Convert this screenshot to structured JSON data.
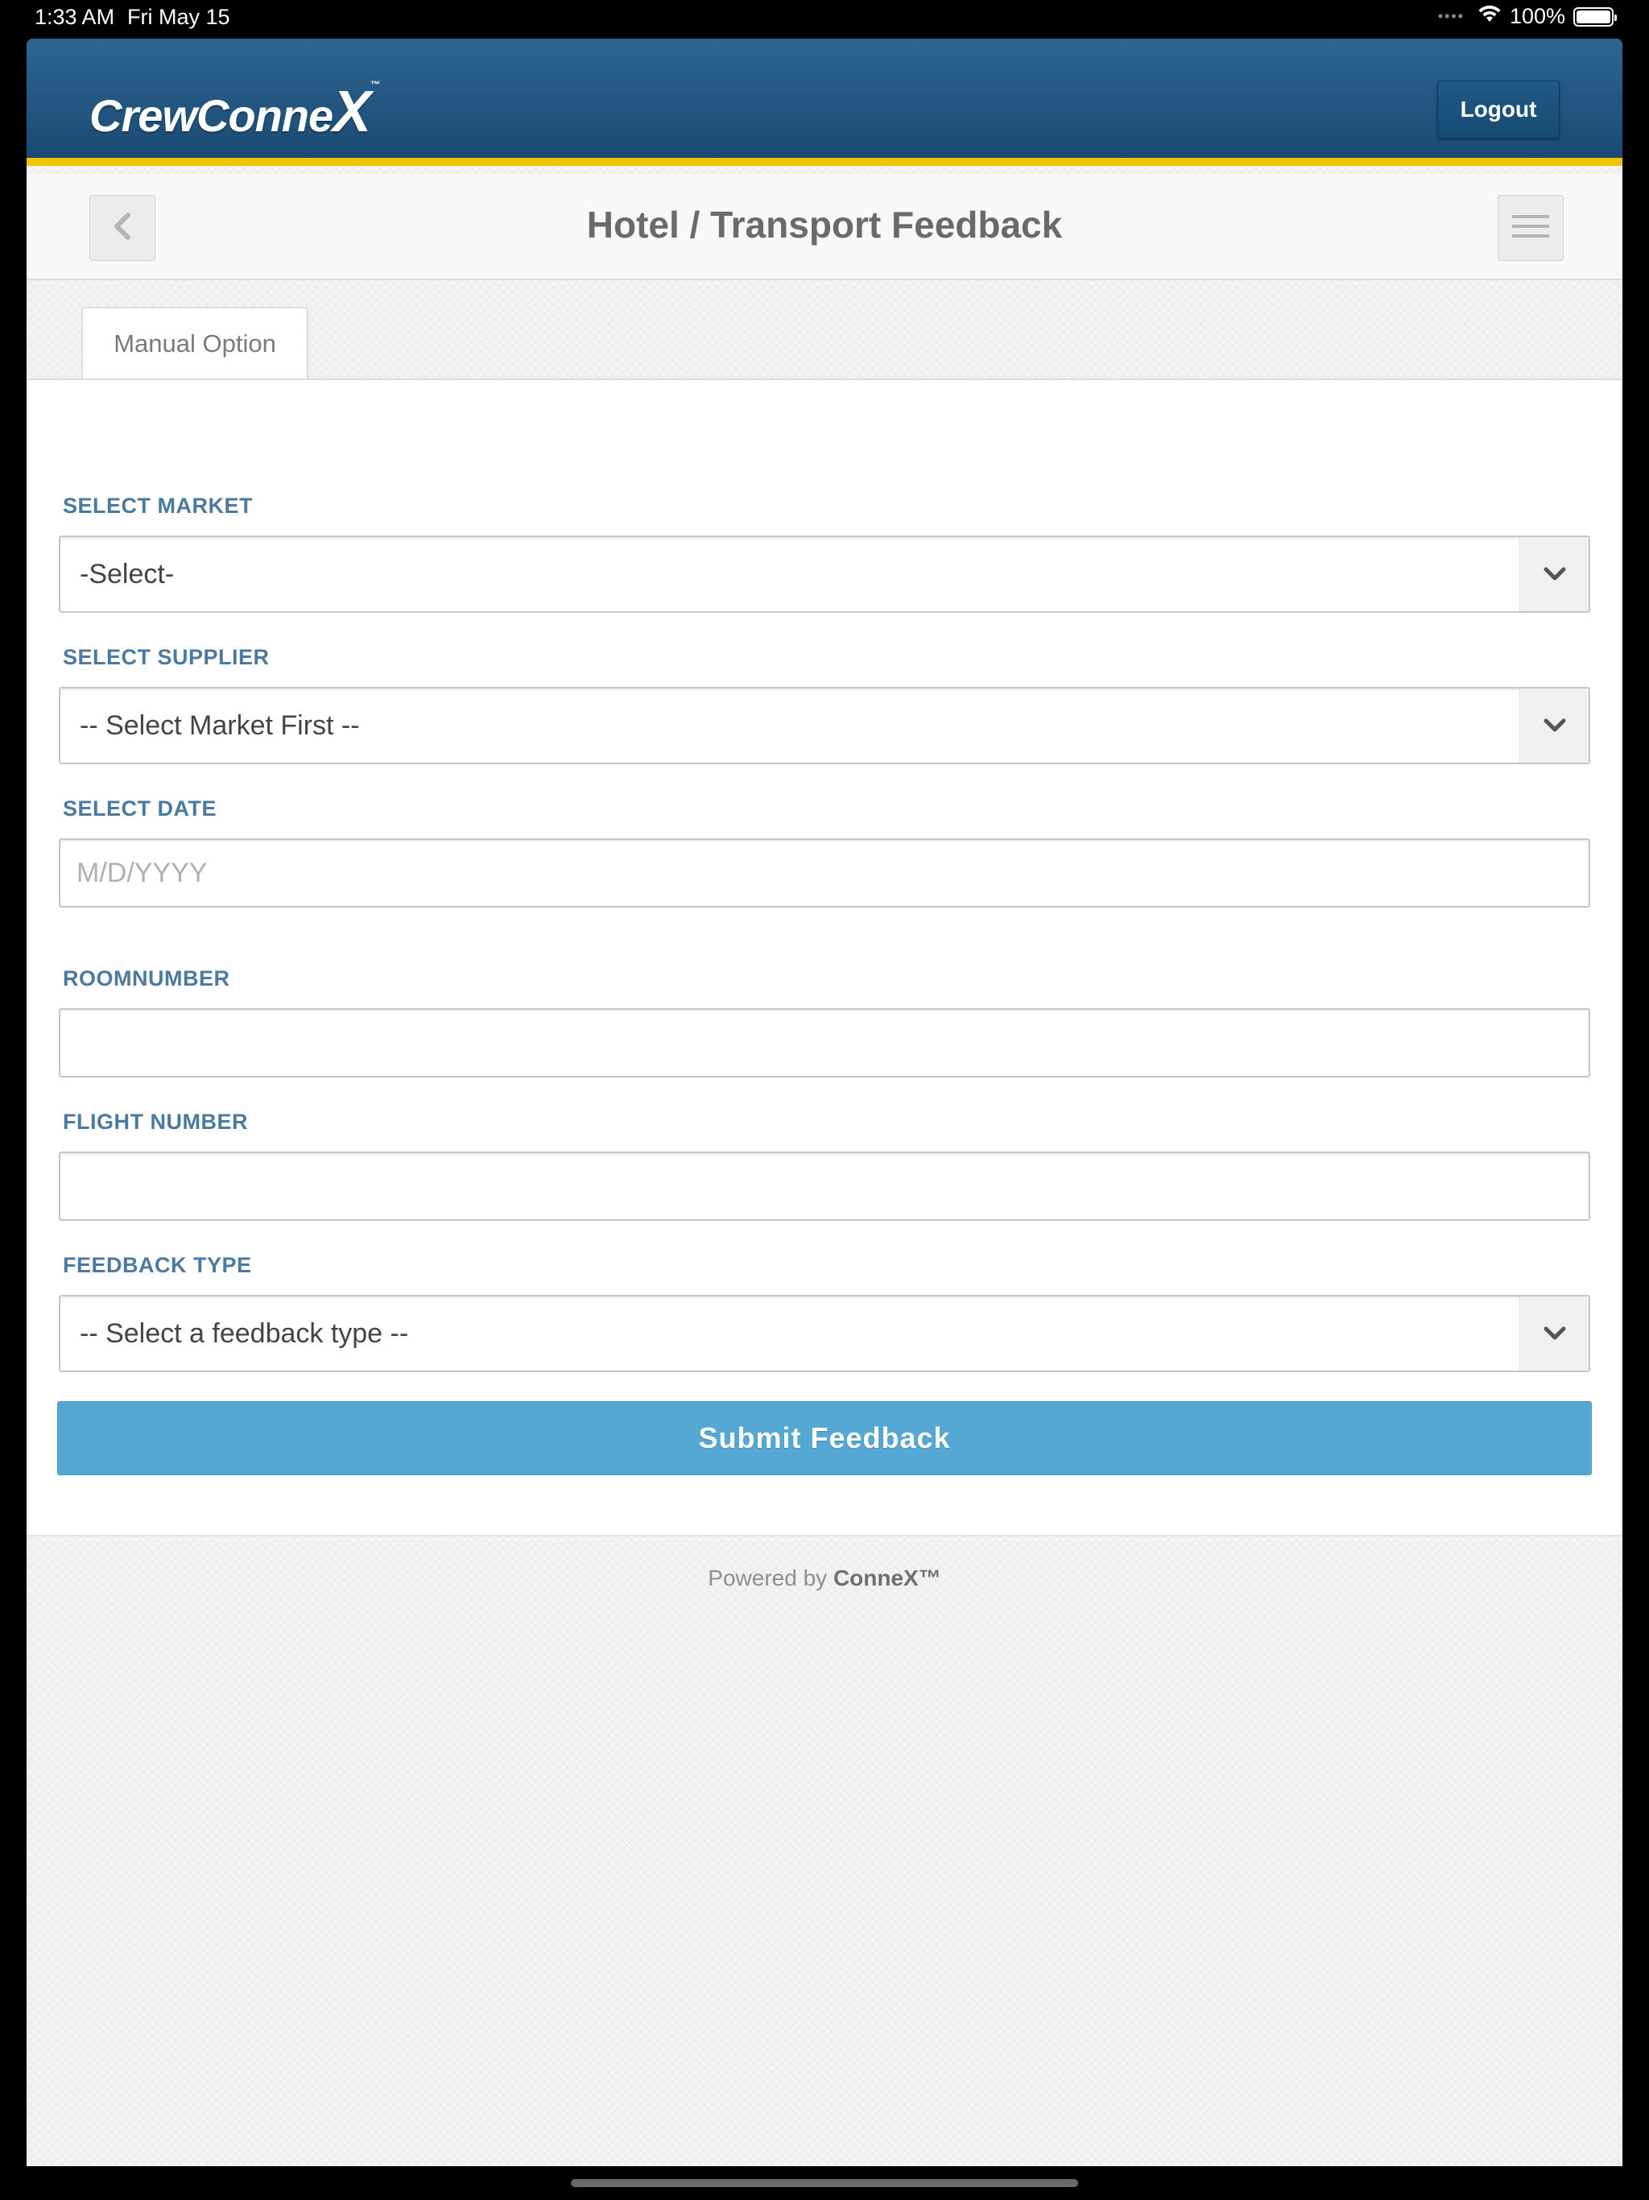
{
  "status_bar": {
    "time": "1:33 AM",
    "date": "Fri May 15",
    "battery": "100%",
    "icons": [
      "wifi-icon",
      "battery-icon"
    ]
  },
  "header": {
    "logo_text": "CrewConne",
    "logo_x": "X",
    "logo_tm": "™",
    "logout_label": "Logout"
  },
  "titlebar": {
    "title": "Hotel / Transport Feedback",
    "back_icon": "chevron-left-icon",
    "menu_icon": "hamburger-menu-icon"
  },
  "tabs": {
    "manual": "Manual Option"
  },
  "form": {
    "market": {
      "label": "SELECT MARKET",
      "value": "-Select-"
    },
    "supplier": {
      "label": "SELECT SUPPLIER",
      "value": "-- Select Market First --"
    },
    "date": {
      "label": "SELECT DATE",
      "placeholder": "M/D/YYYY"
    },
    "room": {
      "label": "ROOMNUMBER",
      "value": ""
    },
    "flight": {
      "label": "FLIGHT NUMBER",
      "value": ""
    },
    "feedback_type": {
      "label": "FEEDBACK TYPE",
      "value": "-- Select a feedback type --"
    },
    "submit_label": "Submit Feedback"
  },
  "footer": {
    "powered_by": "Powered by",
    "brand": "ConneX™"
  },
  "colors": {
    "header_blue": "#1f5a87",
    "accent_yellow": "#f2c400",
    "label_blue": "#4b7aa0",
    "submit_blue": "#56a8d4"
  }
}
